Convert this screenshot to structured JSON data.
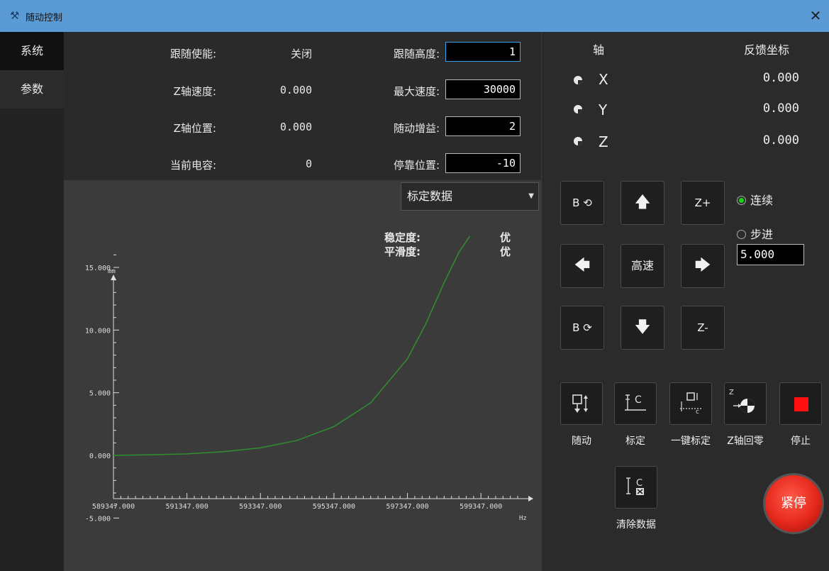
{
  "window": {
    "title": "随动控制",
    "close_glyph": "✕"
  },
  "tabs": [
    {
      "label": "系统"
    },
    {
      "label": "参数"
    }
  ],
  "params": {
    "follow_enable_label": "跟随使能:",
    "follow_enable_value": "关闭",
    "z_speed_label": "Z轴速度:",
    "z_speed_value": "0.000",
    "z_pos_label": "Z轴位置:",
    "z_pos_value": "0.000",
    "capacitance_label": "当前电容:",
    "capacitance_value": "0",
    "follow_height_label": "跟随高度:",
    "follow_height_value": "1",
    "max_speed_label": "最大速度:",
    "max_speed_value": "30000",
    "follow_gain_label": "随动增益:",
    "follow_gain_value": "2",
    "park_pos_label": "停靠位置:",
    "park_pos_value": "-10"
  },
  "chart_select": {
    "value": "标定数据"
  },
  "quality": {
    "stability_label": "稳定度:",
    "stability_value": "优",
    "smoothness_label": "平滑度:",
    "smoothness_value": "优"
  },
  "chart_data": {
    "type": "line",
    "xlabel": "Hz",
    "ylabel": "mm",
    "xlim": [
      589347,
      600347
    ],
    "ylim": [
      -5,
      17
    ],
    "x_ticks": [
      "589347.000",
      "591347.000",
      "593347.000",
      "595347.000",
      "597347.000",
      "599347.000"
    ],
    "y_ticks": [
      "-5.000",
      "0.000",
      "5.000",
      "10.000",
      "15.000"
    ],
    "series": [
      {
        "x": [
          589347,
          590347,
          591347,
          592347,
          593347,
          594347,
          595347,
          596347,
          597347,
          597847,
          598347,
          598747,
          599047
        ],
        "values": [
          0.0,
          0.05,
          0.12,
          0.3,
          0.6,
          1.2,
          2.3,
          4.2,
          7.7,
          10.5,
          13.8,
          16.2,
          17.5
        ]
      }
    ],
    "line_color": "#2f8f2f",
    "grid": false
  },
  "axes_panel": {
    "axis_header": "轴",
    "feedback_header": "反馈坐标",
    "rows": [
      {
        "name": "X",
        "value": "0.000"
      },
      {
        "name": "Y",
        "value": "0.000"
      },
      {
        "name": "Z",
        "value": "0.000"
      }
    ]
  },
  "jog": {
    "b_ccw": "B ⟲",
    "up": "🡅",
    "z_plus": "Z+",
    "left": "🡄",
    "high_speed": "高速",
    "right": "🡆",
    "b_cw": "B ⟳",
    "down": "🡇",
    "z_minus": "Z-"
  },
  "mode": {
    "continuous": "连续",
    "step": "步进",
    "step_value": "5.000"
  },
  "functions": {
    "follow": "随动",
    "calibrate": "标定",
    "one_key_calibrate": "一键标定",
    "z_home": "Z轴回零",
    "stop": "停止",
    "clear_data": "清除数据",
    "estop": "紧停"
  },
  "colors": {
    "accent": "#5b9bd5",
    "stop_red": "#ff1010",
    "radio_green": "#18d418"
  }
}
